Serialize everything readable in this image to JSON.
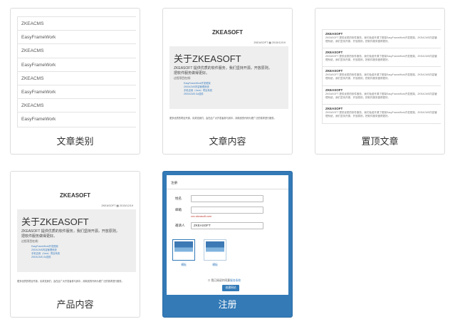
{
  "cards": [
    {
      "caption": "文章类别"
    },
    {
      "caption": "文章内容"
    },
    {
      "caption": "置顶文章"
    },
    {
      "caption": "产品内容"
    },
    {
      "caption": "注册"
    }
  ],
  "category_thumb": {
    "rows": [
      "ZKEACMS",
      "EasyFrameWork",
      "ZKEACMS",
      "EasyFrameWork",
      "ZKEACMS",
      "EasyFrameWork",
      "ZKEACMS",
      "EasyFrameWork"
    ]
  },
  "article_thumb": {
    "site_title": "ZKEASOFT",
    "meta": "ZKEASOFT ▦ 2015/12/19",
    "heading": "关于ZKEASOFT",
    "intro": "ZKEASOFT 提供优质的软件服务，我们坚持开源，开放原则，把软件服务做得更好。",
    "sub": "过程项目在线：",
    "links": [
      "EasyFrameWork开发框架",
      "ZKEACMS内容管理系统",
      "手机应用（Java）项目系统",
      "ZKEACMS.Go插件"
    ],
    "footer": "更多优质的项目开源，请浏览我们，会在此广大开发者参与其中，用精良的代码为更广泛的需求进行服务。"
  },
  "product_thumb": {
    "site_title": "ZKEASOFT",
    "meta": "ZKEASOFT ▦ 2015/12/19",
    "heading": "关于ZKEASOFT",
    "intro": "ZKEASOFT 提供优质的软件服务，我们坚持开源，开放原则，把软件服务做得更好。",
    "sub": "过程项目在线：",
    "links": [
      "EasyFrameWork开发框架",
      "ZKEACMS内容管理系统",
      "手机应用（Java）项目系统",
      "ZKEACMS.Go插件"
    ],
    "footer": "更多优质的项目开源，请浏览我们，会在此广大开发者参与其中，用精良的代码为更广泛的需求进行服务。"
  },
  "pinned_thumb": {
    "items": [
      {
        "title": "ZKEASOFT",
        "desc": "ZKEASOFT 提供优质的软件服务，我们免费开源了框架EasyFrameWork开发框架，ZKEACMS内容管理系统，我们坚持开源，开放原则，把软件服务做得更好。"
      },
      {
        "title": "ZKEASOFT",
        "desc": "ZKEASOFT 提供优质的软件服务，我们免费开源了框架EasyFrameWork开发框架，ZKEACMS内容管理系统，我们坚持开源，开放原则，把软件服务做得更好。"
      },
      {
        "title": "ZKEASOFT",
        "desc": "ZKEASOFT 提供优质的软件服务，我们免费开源了框架EasyFrameWork开发框架，ZKEACMS内容管理系统，我们坚持开源，开放原则，把软件服务做得更好。"
      },
      {
        "title": "ZKEASOFT",
        "desc": "ZKEASOFT 提供优质的软件服务，我们免费开源了框架EasyFrameWork开发框架，ZKEACMS内容管理系统，我们坚持开源，开放原则，把软件服务做得更好。"
      },
      {
        "title": "ZKEASOFT",
        "desc": "ZKEASOFT 提供优质的软件服务，我们免费开源了框架EasyFrameWork开发框架，ZKEACMS内容管理系统，我们坚持开源，开放原则，把软件服务做得更好。"
      }
    ]
  },
  "register_thumb": {
    "header": "注册",
    "name_label": "姓名",
    "email_label": "邮箱",
    "email_hint": "xxx.zkeasoft.com",
    "invite_label": "邀请人",
    "invite_value": "ZKEASOFT",
    "templates": [
      "模板",
      "模板"
    ],
    "agree_text": "我已阅读并同意",
    "agree_link": "服务条款",
    "submit": "创建网站"
  }
}
